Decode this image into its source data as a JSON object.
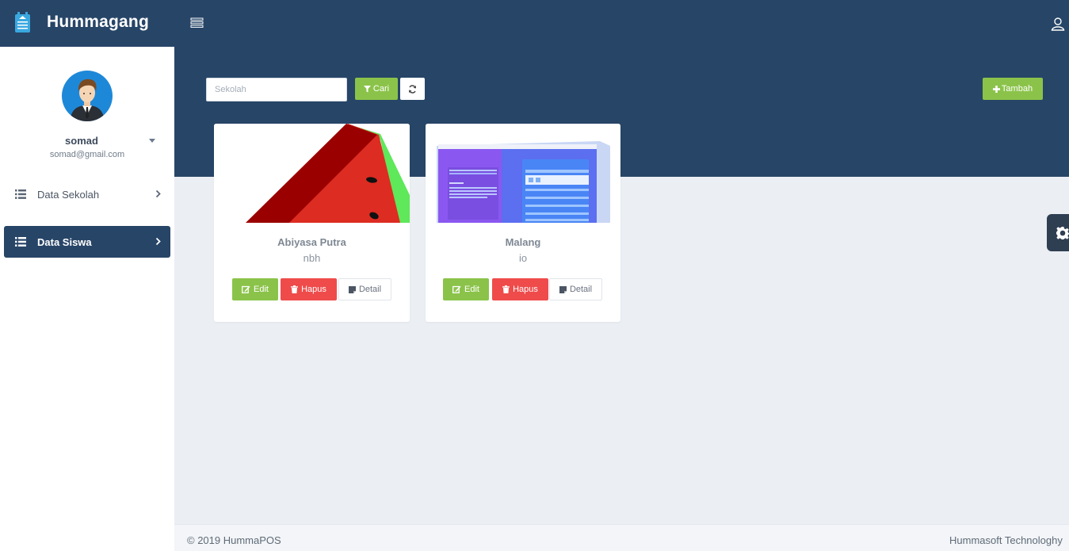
{
  "app": {
    "brand": "Hummagang"
  },
  "profile": {
    "name": "somad",
    "email": "somad@gmail.com"
  },
  "sidebar": {
    "items": [
      {
        "label": "Data Sekolah",
        "active": false
      },
      {
        "label": "Data Siswa",
        "active": true
      }
    ]
  },
  "toolbar": {
    "search_placeholder": "Sekolah",
    "search_value": "",
    "cari_label": "Cari",
    "tambah_label": "Tambah"
  },
  "cards": [
    {
      "title": "Abiyasa Putra",
      "subtitle": "nbh",
      "edit_label": "Edit",
      "hapus_label": "Hapus",
      "detail_label": "Detail"
    },
    {
      "title": "Malang",
      "subtitle": "io",
      "edit_label": "Edit",
      "hapus_label": "Hapus",
      "detail_label": "Detail"
    }
  ],
  "footer": {
    "left": "© 2019 HummaPOS",
    "right": "Hummasoft Technologhy"
  },
  "colors": {
    "navy": "#274567",
    "green": "#8bc34a",
    "red": "#ef4b4b",
    "background": "#ebeef3"
  }
}
